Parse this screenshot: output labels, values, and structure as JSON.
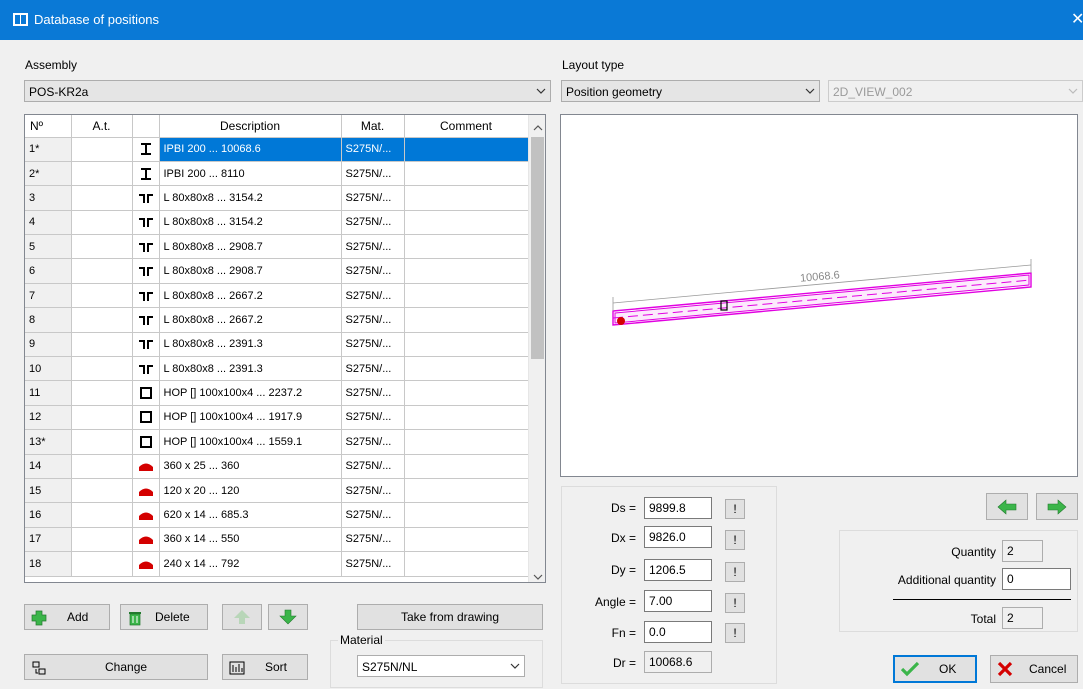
{
  "window": {
    "title": "Database of positions",
    "close_glyph": "✕"
  },
  "assembly": {
    "label": "Assembly",
    "value": "POS-KR2a"
  },
  "layout": {
    "label": "Layout type",
    "value": "Position geometry",
    "view_value": "2D_VIEW_002"
  },
  "table": {
    "columns": [
      "Nº",
      "A.t.",
      "",
      "Description",
      "Mat.",
      "Comment"
    ],
    "rows": [
      {
        "nr": "1*",
        "at": "",
        "icon": "i-beam-icon",
        "desc": "IPBI 200 ... 10068.6",
        "mat": "S275N/...",
        "comment": "",
        "selected": true
      },
      {
        "nr": "2*",
        "at": "",
        "icon": "i-beam-icon",
        "desc": "IPBI 200 ... 8110",
        "mat": "S275N/...",
        "comment": ""
      },
      {
        "nr": "3",
        "at": "",
        "icon": "double-angle-icon",
        "desc": "L 80x80x8 ... 3154.2",
        "mat": "S275N/...",
        "comment": ""
      },
      {
        "nr": "4",
        "at": "",
        "icon": "double-angle-icon",
        "desc": "L 80x80x8 ... 3154.2",
        "mat": "S275N/...",
        "comment": ""
      },
      {
        "nr": "5",
        "at": "",
        "icon": "double-angle-icon",
        "desc": "L 80x80x8 ... 2908.7",
        "mat": "S275N/...",
        "comment": ""
      },
      {
        "nr": "6",
        "at": "",
        "icon": "double-angle-icon",
        "desc": "L 80x80x8 ... 2908.7",
        "mat": "S275N/...",
        "comment": ""
      },
      {
        "nr": "7",
        "at": "",
        "icon": "double-angle-icon",
        "desc": "L 80x80x8 ... 2667.2",
        "mat": "S275N/...",
        "comment": ""
      },
      {
        "nr": "8",
        "at": "",
        "icon": "double-angle-icon",
        "desc": "L 80x80x8 ... 2667.2",
        "mat": "S275N/...",
        "comment": ""
      },
      {
        "nr": "9",
        "at": "",
        "icon": "double-angle-icon",
        "desc": "L 80x80x8 ... 2391.3",
        "mat": "S275N/...",
        "comment": ""
      },
      {
        "nr": "10",
        "at": "",
        "icon": "double-angle-icon",
        "desc": "L 80x80x8 ... 2391.3",
        "mat": "S275N/...",
        "comment": ""
      },
      {
        "nr": "11",
        "at": "",
        "icon": "hollow-square-icon",
        "desc": "HOP [] 100x100x4 ... 2237.2",
        "mat": "S275N/...",
        "comment": ""
      },
      {
        "nr": "12",
        "at": "",
        "icon": "hollow-square-icon",
        "desc": "HOP [] 100x100x4 ... 1917.9",
        "mat": "S275N/...",
        "comment": ""
      },
      {
        "nr": "13*",
        "at": "",
        "icon": "hollow-square-icon",
        "desc": "HOP [] 100x100x4 ... 1559.1",
        "mat": "S275N/...",
        "comment": ""
      },
      {
        "nr": "14",
        "at": "",
        "icon": "plate-icon",
        "desc": "360 x 25 ... 360",
        "mat": "S275N/...",
        "comment": ""
      },
      {
        "nr": "15",
        "at": "",
        "icon": "plate-icon",
        "desc": "120 x 20 ... 120",
        "mat": "S275N/...",
        "comment": ""
      },
      {
        "nr": "16",
        "at": "",
        "icon": "plate-icon",
        "desc": "620 x 14 ... 685.3",
        "mat": "S275N/...",
        "comment": ""
      },
      {
        "nr": "17",
        "at": "",
        "icon": "plate-icon",
        "desc": "360 x 14 ... 550",
        "mat": "S275N/...",
        "comment": ""
      },
      {
        "nr": "18",
        "at": "",
        "icon": "plate-icon",
        "desc": "240 x 14 ... 792",
        "mat": "S275N/...",
        "comment": ""
      }
    ]
  },
  "buttons": {
    "add": "Add",
    "delete": "Delete",
    "take_from_drawing": "Take from drawing",
    "change": "Change",
    "sort": "Sort",
    "ok": "OK",
    "cancel": "Cancel"
  },
  "material": {
    "label": "Material",
    "value": "S275N/NL"
  },
  "preview": {
    "dimension_label": "10068.6"
  },
  "geometry": {
    "ds": {
      "label": "Ds =",
      "value": "9899.8"
    },
    "dx": {
      "label": "Dx =",
      "value": "9826.0"
    },
    "dy": {
      "label": "Dy =",
      "value": "1206.5"
    },
    "angle": {
      "label": "Angle =",
      "value": "7.00"
    },
    "fn": {
      "label": "Fn =",
      "value": "0.0"
    },
    "dr": {
      "label": "Dr =",
      "value": "10068.6"
    },
    "pick_glyph": "!"
  },
  "quantities": {
    "quantity": {
      "label": "Quantity",
      "value": "2"
    },
    "additional": {
      "label": "Additional quantity",
      "value": "0"
    },
    "total": {
      "label": "Total",
      "value": "2"
    }
  },
  "colors": {
    "titlebar": "#0a79d6",
    "selection": "#0078d7",
    "profile_magenta": "#e100e1",
    "plate_red": "#d40000",
    "arrow_green": "#3bb54a"
  }
}
